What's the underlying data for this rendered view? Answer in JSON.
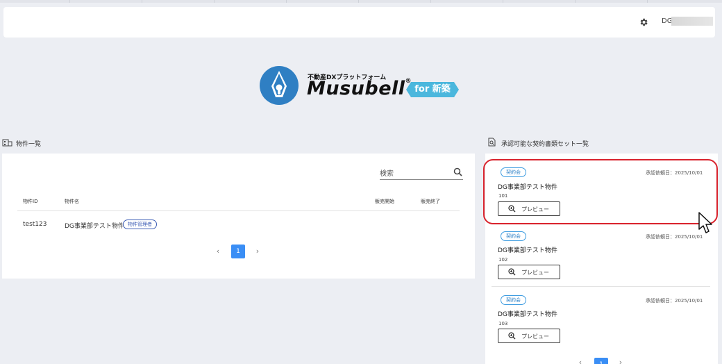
{
  "header": {
    "settings_icon": "gear-icon",
    "user_name": "DG"
  },
  "logo": {
    "subtitle": "不動産DXプラットフォーム",
    "brand": "Musubell",
    "registered": "®",
    "badge": "for 新築",
    "brand_color": "#2f7fc3",
    "badge_color": "#4bb7dd"
  },
  "properties": {
    "title": "物件一覧",
    "icon": "building-icon",
    "search_placeholder": "検索",
    "columns": [
      "物件ID",
      "物件名",
      "販売開始",
      "販売終了"
    ],
    "rows": [
      {
        "id": "test123",
        "name": "DG事業部テスト物件",
        "role": "物件管理者",
        "start": "",
        "end": ""
      }
    ],
    "pagination": {
      "current": "1",
      "prev": "‹",
      "next": "›"
    }
  },
  "contracts": {
    "title": "承認可能な契約書類セット一覧",
    "icon": "document-search-icon",
    "cards": [
      {
        "tag": "契約会",
        "date": "承認依頼日：2025/10/01",
        "name": "DG事業部テスト物件",
        "number": "101",
        "button": "プレビュー"
      },
      {
        "tag": "契約会",
        "date": "承認依頼日：2025/10/01",
        "name": "DG事業部テスト物件",
        "number": "102",
        "button": "プレビュー"
      },
      {
        "tag": "契約会",
        "date": "承認依頼日：2025/10/01",
        "name": "DG事業部テスト物件",
        "number": "103",
        "button": "プレビュー"
      }
    ],
    "pagination": {
      "current": "1",
      "prev": "‹",
      "next": "›"
    }
  },
  "colors": {
    "accent": "#3a8ef5",
    "highlight": "#d9232d"
  }
}
